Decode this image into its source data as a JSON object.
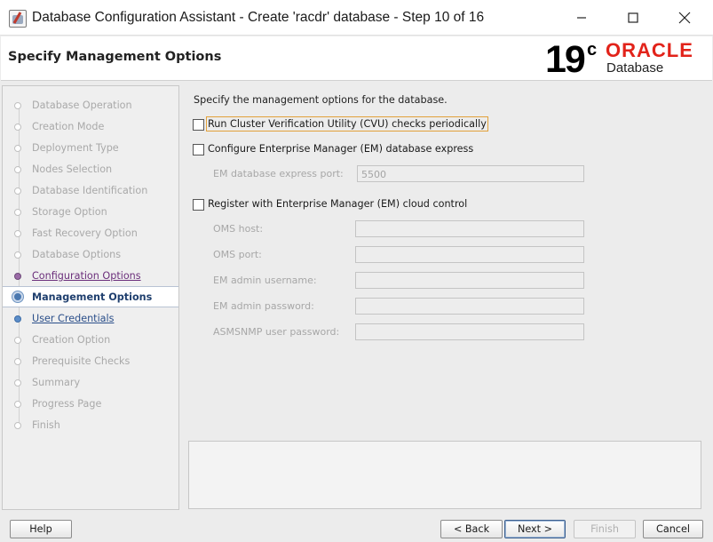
{
  "window": {
    "title": "Database Configuration Assistant - Create 'racdr' database - Step 10 of 16",
    "controls": [
      "minimize-icon",
      "maximize-icon",
      "close-icon"
    ]
  },
  "header": {
    "page_title": "Specify Management Options",
    "logo": {
      "version": "19",
      "version_suffix": "c",
      "brand": "ORACLE",
      "product": "Database",
      "brand_color": "#e2231a"
    }
  },
  "nav": {
    "items": [
      {
        "label": "Database Operation",
        "state": "disabled"
      },
      {
        "label": "Creation Mode",
        "state": "disabled"
      },
      {
        "label": "Deployment Type",
        "state": "disabled"
      },
      {
        "label": "Nodes Selection",
        "state": "disabled"
      },
      {
        "label": "Database Identification",
        "state": "disabled"
      },
      {
        "label": "Storage Option",
        "state": "disabled"
      },
      {
        "label": "Fast Recovery Option",
        "state": "disabled"
      },
      {
        "label": "Database Options",
        "state": "disabled"
      },
      {
        "label": "Configuration Options",
        "state": "visited"
      },
      {
        "label": "Management Options",
        "state": "current"
      },
      {
        "label": "User Credentials",
        "state": "next"
      },
      {
        "label": "Creation Option",
        "state": "disabled"
      },
      {
        "label": "Prerequisite Checks",
        "state": "disabled"
      },
      {
        "label": "Summary",
        "state": "disabled"
      },
      {
        "label": "Progress Page",
        "state": "disabled"
      },
      {
        "label": "Finish",
        "state": "disabled"
      }
    ]
  },
  "content": {
    "intro": "Specify the management options for the database.",
    "cvu_checkbox": {
      "label": "Run Cluster Verification Utility (CVU) checks periodically",
      "checked": false
    },
    "em_express_checkbox": {
      "label": "Configure Enterprise Manager (EM) database express",
      "checked": false
    },
    "em_express_port": {
      "label": "EM database express port:",
      "value": "5500"
    },
    "cloud_control_checkbox": {
      "label": "Register with Enterprise Manager (EM) cloud control",
      "checked": false
    },
    "oms_host": {
      "label": "OMS host:",
      "value": ""
    },
    "oms_port": {
      "label": "OMS port:",
      "value": ""
    },
    "em_admin_username": {
      "label": "EM admin username:",
      "value": ""
    },
    "em_admin_password": {
      "label": "EM admin password:",
      "value": ""
    },
    "asmsnmp_password": {
      "label": "ASMSNMP user password:",
      "value": ""
    }
  },
  "buttons": {
    "help": "Help",
    "back": "< Back",
    "next": "Next >",
    "finish": "Finish",
    "cancel": "Cancel"
  }
}
